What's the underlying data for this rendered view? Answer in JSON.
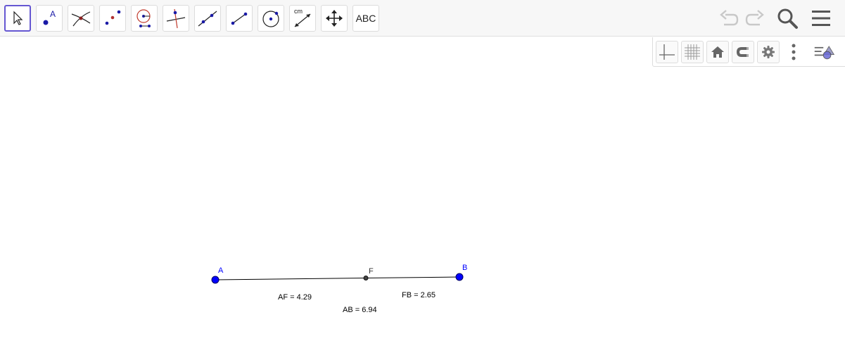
{
  "toolbar": {
    "tools": [
      {
        "name": "move",
        "icon": "arrow-cursor-icon"
      },
      {
        "name": "point",
        "icon": "point-icon"
      },
      {
        "name": "intersect",
        "icon": "intersect-icon"
      },
      {
        "name": "midpoint",
        "icon": "midpoint-icon"
      },
      {
        "name": "circle-with-center",
        "icon": "circle-radius-icon"
      },
      {
        "name": "perpendicular-line",
        "icon": "perpendicular-icon"
      },
      {
        "name": "line",
        "icon": "line-icon"
      },
      {
        "name": "segment",
        "icon": "segment-icon"
      },
      {
        "name": "circle-center-point",
        "icon": "circle-center-point-icon"
      },
      {
        "name": "distance",
        "icon": "distance-icon"
      },
      {
        "name": "move-graphics-view",
        "icon": "move-view-icon"
      },
      {
        "name": "text",
        "icon": "text-icon"
      }
    ],
    "distance_unit": "cm",
    "text_tool_label": "ABC",
    "right": [
      "undo-icon",
      "redo-icon",
      "search-icon",
      "menu-icon"
    ]
  },
  "style_bar": [
    "axes-icon",
    "grid-icon",
    "home-icon",
    "magnet-icon",
    "gear-icon",
    "more-vert-icon",
    "style-bar-toggle-icon"
  ],
  "construction": {
    "points": [
      {
        "label": "A",
        "color": "#0000ff"
      },
      {
        "label": "B",
        "color": "#0000ff"
      },
      {
        "label": "F",
        "color": "#333333"
      }
    ],
    "measurements": {
      "af": "AF = 4.29",
      "fb": "FB = 2.65",
      "ab": "AB = 6.94"
    }
  },
  "colors": {
    "accent": "#6557d2",
    "point_free": "#0000ff",
    "point_dependent": "#333333",
    "icon_gray": "#666666"
  }
}
